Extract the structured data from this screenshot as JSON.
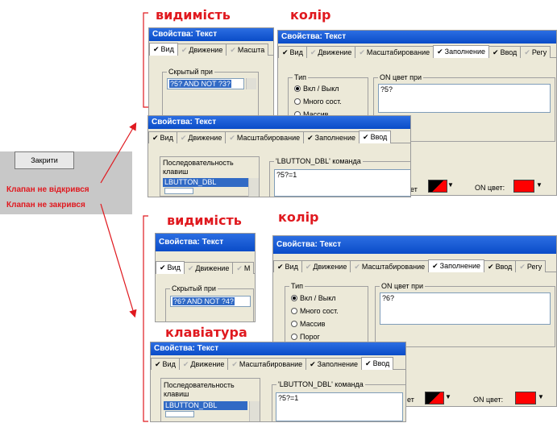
{
  "left_widget": {
    "button_label": "Закрити",
    "msg_open": "Клапан не відкрився",
    "msg_close": "Клапан не закрився"
  },
  "annotations": {
    "vis": "видимість",
    "color": "колір",
    "keyboard": "клавіатура"
  },
  "win": {
    "title": "Свойства: Текст",
    "tabs": {
      "vid": "Вид",
      "dvizh": "Движение",
      "masht": "Масштабирование",
      "masht_short": "Масшта",
      "zapoln": "Заполнение",
      "vvod": "Ввод",
      "reg": "Регу"
    },
    "hidden_label": "Скрытый при",
    "hidden_value_1": "?5? AND NOT ?3?",
    "hidden_value_2": "?6? AND NOT ?4?",
    "type_label": "Тип",
    "type_options": [
      "Вкл / Выкл",
      "Много сост.",
      "Массив",
      "Порог"
    ],
    "on_color_label": "ON цвет при",
    "on_color_value_1": "?5?",
    "on_color_value_2": "?6?",
    "seq_label_line1": "Последовательность",
    "seq_label_line2": "клавиш",
    "seq_item": "LBUTTON_DBL",
    "cmd_label": "'LBUTTON_DBL' команда",
    "cmd_value": "?5?=1",
    "off_color_tail": "ет",
    "on_color_field": "ON цвет:",
    "on_color_field2": "ON цвет:"
  },
  "colors": {
    "accent_red": "#e0191f",
    "title_blue": "#0a4cc8",
    "swatch_red": "#ff0000"
  }
}
